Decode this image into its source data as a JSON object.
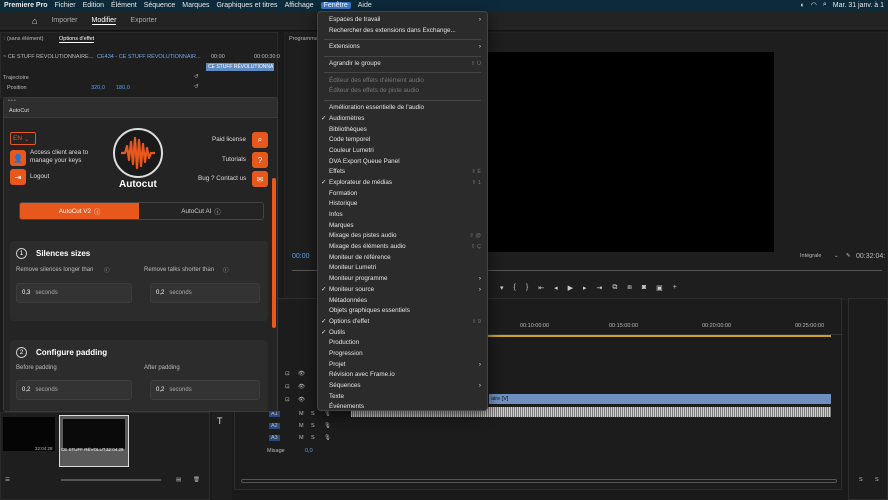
{
  "menubar": {
    "app": "Premiere Pro",
    "items": [
      "Fichier",
      "Edition",
      "Élément",
      "Séquence",
      "Marques",
      "Graphiques et titres",
      "Affichage",
      "Fenêtre",
      "Aide"
    ],
    "clock": "Mar. 31 janv. à 1"
  },
  "header": {
    "tabs": [
      "Importer",
      "Modifier",
      "Exporter"
    ]
  },
  "effect_controls": {
    "tab_sans": ": (sans élément)",
    "tab": "Options d'effet",
    "source": "~ CE STUFF RÉVOLUTIONNAIRE...",
    "sequence": "CE434 - CE STUFF RÉVOLUTIONNAIR...",
    "clip_label": "CE STUFF RÉVOLUTIONNA",
    "tc1": "00:00",
    "tc2": "00:00:30:0",
    "section": "Trajectoire",
    "position_label": "Position",
    "position_x": "320,0",
    "position_y": "180,0"
  },
  "program": {
    "title": "Programme",
    "timecode": "00:00",
    "fit": "Intégrale",
    "duration": "00:32:04:"
  },
  "menu": {
    "items": [
      {
        "label": "Espaces de travail",
        "arrow": true
      },
      {
        "label": "Rechercher des extensions dans Exchange..."
      },
      {
        "sep": true
      },
      {
        "label": "Extensions",
        "arrow": true
      },
      {
        "sep": true
      },
      {
        "label": "Agrandir le groupe",
        "shortcut": "⇧ Ù"
      },
      {
        "sep": true
      },
      {
        "label": "Éditeur des effets d'élément audio",
        "disabled": true
      },
      {
        "label": "Éditeur des effets de piste audio",
        "disabled": true
      },
      {
        "sep": true
      },
      {
        "label": "Amélioration essentielle de l'audio"
      },
      {
        "label": "Audiomètres",
        "checked": true
      },
      {
        "label": "Bibliothèques"
      },
      {
        "label": "Code temporel"
      },
      {
        "label": "Couleur Lumetri"
      },
      {
        "label": "DVA Export Queue Panel"
      },
      {
        "label": "Effets",
        "shortcut": "⇧ È"
      },
      {
        "label": "Explorateur de médias",
        "checked": true,
        "shortcut": "⇧ 1"
      },
      {
        "label": "Formation"
      },
      {
        "label": "Historique"
      },
      {
        "label": "Infos"
      },
      {
        "label": "Marques"
      },
      {
        "label": "Mixage des pistes audio",
        "shortcut": "⇧ @"
      },
      {
        "label": "Mixage des éléments audio",
        "shortcut": "⇧ Ç"
      },
      {
        "label": "Moniteur de référence"
      },
      {
        "label": "Moniteur Lumetri"
      },
      {
        "label": "Moniteur programme",
        "arrow": true
      },
      {
        "label": "Moniteur source",
        "checked": true,
        "arrow": true
      },
      {
        "label": "Métadonnées"
      },
      {
        "label": "Objets graphiques essentiels"
      },
      {
        "label": "Options d'effet",
        "checked": true,
        "shortcut": "⇧ 9"
      },
      {
        "label": "Outils",
        "checked": true
      },
      {
        "label": "Production"
      },
      {
        "label": "Progression"
      },
      {
        "label": "Projet",
        "arrow": true
      },
      {
        "label": "Révision avec Frame.io"
      },
      {
        "label": "Séquences",
        "arrow": true
      },
      {
        "label": "Texte"
      },
      {
        "label": "Événements"
      }
    ]
  },
  "autocut": {
    "title": "AutoCut",
    "lang": "EN",
    "access_text": "Access client area to manage your keys",
    "logout": "Logout",
    "brand": "Autocut",
    "paid_license": "Paid license",
    "tutorials": "Tutorials",
    "bug": "Bug ? Contact us",
    "tab_v2": "AutoCut V2",
    "tab_ai": "AutoCut AI",
    "step1_num": "1",
    "step1_title": "Silences sizes",
    "remove_silences": "Remove silences longer than",
    "remove_talks": "Remove talks shorter than",
    "silence_value": "0,3",
    "talk_value": "0,2",
    "unit": "seconds",
    "step2_num": "2",
    "step2_title": "Configure padding",
    "before_padding": "Before padding",
    "after_padding": "After padding",
    "before_value": "0,2",
    "after_value": "0,2"
  },
  "timeline": {
    "ruler": [
      "00:10:00:00",
      "00:15:00:00",
      "00:20:00:00",
      "00:25:00:00"
    ],
    "audio_tracks": [
      "A1",
      "A2",
      "A3"
    ],
    "mix_label": "Mixage",
    "mix_value": "0,0",
    "clip_label": "aire [V]"
  },
  "project": {
    "thumb1_time": "32:04:28",
    "thumb2_label": "CE STUFF RÉVOLUT...",
    "thumb2_time": "32:04:28"
  },
  "colors": {
    "accent": "#e8581d",
    "menu_bg": "#2b2b2b",
    "video_clip": "#6e8fbf"
  }
}
